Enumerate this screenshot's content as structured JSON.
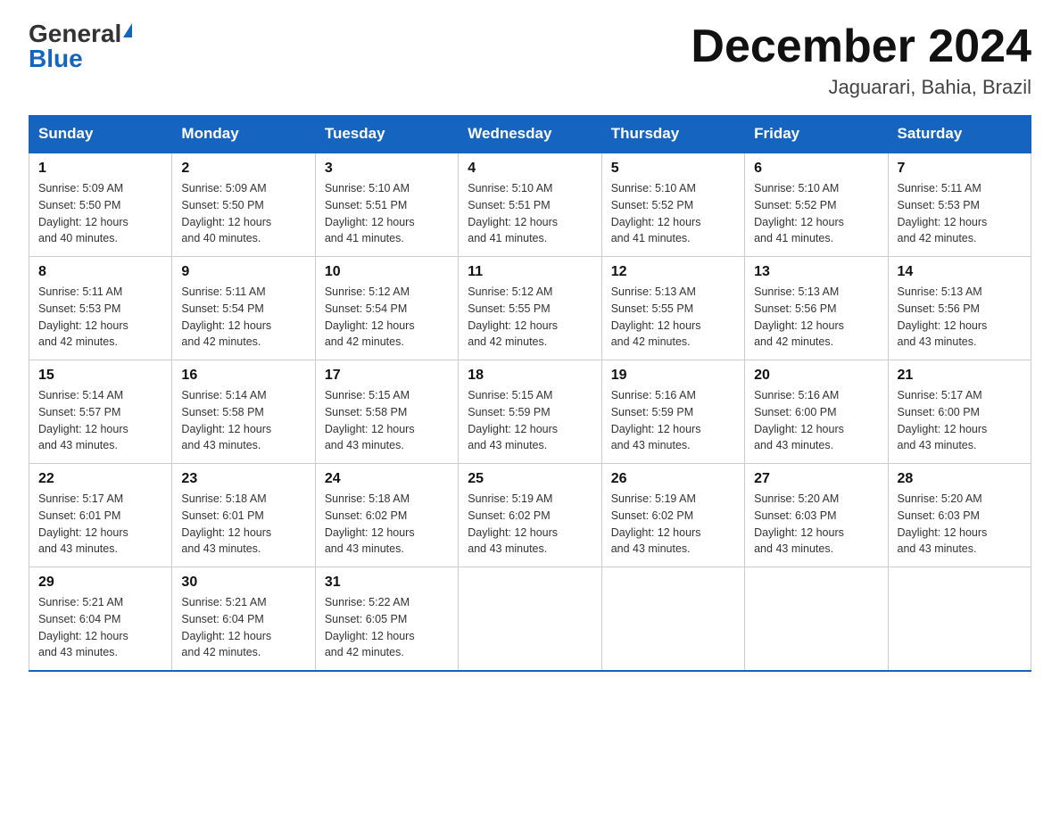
{
  "header": {
    "logo_general": "General",
    "logo_blue": "Blue",
    "month_title": "December 2024",
    "location": "Jaguarari, Bahia, Brazil"
  },
  "days_of_week": [
    "Sunday",
    "Monday",
    "Tuesday",
    "Wednesday",
    "Thursday",
    "Friday",
    "Saturday"
  ],
  "weeks": [
    [
      {
        "day": "1",
        "sunrise": "5:09 AM",
        "sunset": "5:50 PM",
        "daylight": "12 hours and 40 minutes."
      },
      {
        "day": "2",
        "sunrise": "5:09 AM",
        "sunset": "5:50 PM",
        "daylight": "12 hours and 40 minutes."
      },
      {
        "day": "3",
        "sunrise": "5:10 AM",
        "sunset": "5:51 PM",
        "daylight": "12 hours and 41 minutes."
      },
      {
        "day": "4",
        "sunrise": "5:10 AM",
        "sunset": "5:51 PM",
        "daylight": "12 hours and 41 minutes."
      },
      {
        "day": "5",
        "sunrise": "5:10 AM",
        "sunset": "5:52 PM",
        "daylight": "12 hours and 41 minutes."
      },
      {
        "day": "6",
        "sunrise": "5:10 AM",
        "sunset": "5:52 PM",
        "daylight": "12 hours and 41 minutes."
      },
      {
        "day": "7",
        "sunrise": "5:11 AM",
        "sunset": "5:53 PM",
        "daylight": "12 hours and 42 minutes."
      }
    ],
    [
      {
        "day": "8",
        "sunrise": "5:11 AM",
        "sunset": "5:53 PM",
        "daylight": "12 hours and 42 minutes."
      },
      {
        "day": "9",
        "sunrise": "5:11 AM",
        "sunset": "5:54 PM",
        "daylight": "12 hours and 42 minutes."
      },
      {
        "day": "10",
        "sunrise": "5:12 AM",
        "sunset": "5:54 PM",
        "daylight": "12 hours and 42 minutes."
      },
      {
        "day": "11",
        "sunrise": "5:12 AM",
        "sunset": "5:55 PM",
        "daylight": "12 hours and 42 minutes."
      },
      {
        "day": "12",
        "sunrise": "5:13 AM",
        "sunset": "5:55 PM",
        "daylight": "12 hours and 42 minutes."
      },
      {
        "day": "13",
        "sunrise": "5:13 AM",
        "sunset": "5:56 PM",
        "daylight": "12 hours and 42 minutes."
      },
      {
        "day": "14",
        "sunrise": "5:13 AM",
        "sunset": "5:56 PM",
        "daylight": "12 hours and 43 minutes."
      }
    ],
    [
      {
        "day": "15",
        "sunrise": "5:14 AM",
        "sunset": "5:57 PM",
        "daylight": "12 hours and 43 minutes."
      },
      {
        "day": "16",
        "sunrise": "5:14 AM",
        "sunset": "5:58 PM",
        "daylight": "12 hours and 43 minutes."
      },
      {
        "day": "17",
        "sunrise": "5:15 AM",
        "sunset": "5:58 PM",
        "daylight": "12 hours and 43 minutes."
      },
      {
        "day": "18",
        "sunrise": "5:15 AM",
        "sunset": "5:59 PM",
        "daylight": "12 hours and 43 minutes."
      },
      {
        "day": "19",
        "sunrise": "5:16 AM",
        "sunset": "5:59 PM",
        "daylight": "12 hours and 43 minutes."
      },
      {
        "day": "20",
        "sunrise": "5:16 AM",
        "sunset": "6:00 PM",
        "daylight": "12 hours and 43 minutes."
      },
      {
        "day": "21",
        "sunrise": "5:17 AM",
        "sunset": "6:00 PM",
        "daylight": "12 hours and 43 minutes."
      }
    ],
    [
      {
        "day": "22",
        "sunrise": "5:17 AM",
        "sunset": "6:01 PM",
        "daylight": "12 hours and 43 minutes."
      },
      {
        "day": "23",
        "sunrise": "5:18 AM",
        "sunset": "6:01 PM",
        "daylight": "12 hours and 43 minutes."
      },
      {
        "day": "24",
        "sunrise": "5:18 AM",
        "sunset": "6:02 PM",
        "daylight": "12 hours and 43 minutes."
      },
      {
        "day": "25",
        "sunrise": "5:19 AM",
        "sunset": "6:02 PM",
        "daylight": "12 hours and 43 minutes."
      },
      {
        "day": "26",
        "sunrise": "5:19 AM",
        "sunset": "6:02 PM",
        "daylight": "12 hours and 43 minutes."
      },
      {
        "day": "27",
        "sunrise": "5:20 AM",
        "sunset": "6:03 PM",
        "daylight": "12 hours and 43 minutes."
      },
      {
        "day": "28",
        "sunrise": "5:20 AM",
        "sunset": "6:03 PM",
        "daylight": "12 hours and 43 minutes."
      }
    ],
    [
      {
        "day": "29",
        "sunrise": "5:21 AM",
        "sunset": "6:04 PM",
        "daylight": "12 hours and 43 minutes."
      },
      {
        "day": "30",
        "sunrise": "5:21 AM",
        "sunset": "6:04 PM",
        "daylight": "12 hours and 42 minutes."
      },
      {
        "day": "31",
        "sunrise": "5:22 AM",
        "sunset": "6:05 PM",
        "daylight": "12 hours and 42 minutes."
      },
      null,
      null,
      null,
      null
    ]
  ],
  "labels": {
    "sunrise": "Sunrise:",
    "sunset": "Sunset:",
    "daylight": "Daylight:"
  }
}
